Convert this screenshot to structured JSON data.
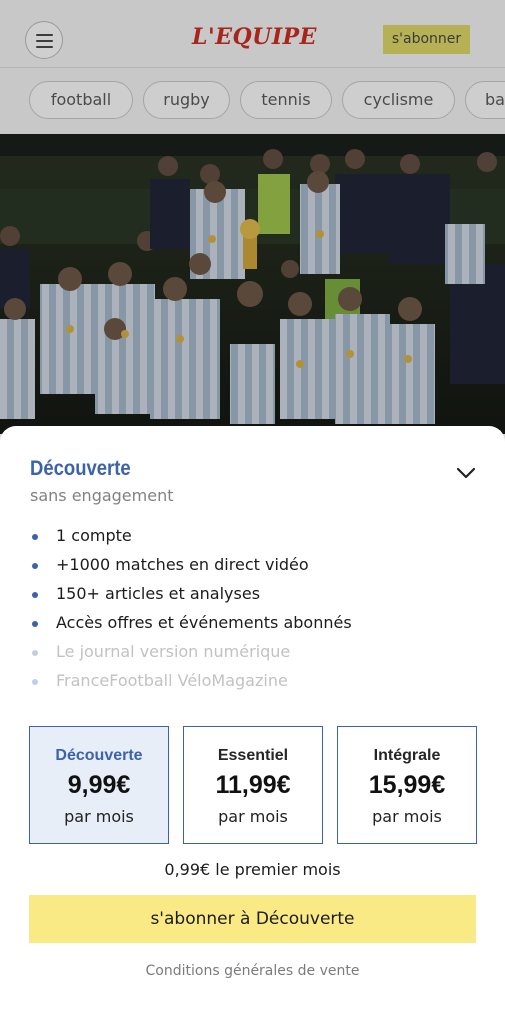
{
  "header": {
    "logo": "L'EQUIPE",
    "subscribe_label": "s'abonner"
  },
  "sports": [
    "football",
    "rugby",
    "tennis",
    "cyclisme",
    "ba"
  ],
  "offer": {
    "title": "Découverte",
    "subtitle": "sans engagement",
    "features": [
      {
        "label": "1 compte",
        "included": true
      },
      {
        "label": "+1000 matches en direct vidéo",
        "included": true
      },
      {
        "label": "150+ articles et analyses",
        "included": true
      },
      {
        "label": "Accès offres et événements abonnés",
        "included": true
      },
      {
        "label": "Le journal version numérique",
        "included": false
      },
      {
        "label": "FranceFootball VéloMagazine",
        "included": false
      }
    ],
    "plans": [
      {
        "name": "Découverte",
        "price": "9,99€",
        "period": "par mois",
        "selected": true
      },
      {
        "name": "Essentiel",
        "price": "11,99€",
        "period": "par mois",
        "selected": false
      },
      {
        "name": "Intégrale",
        "price": "15,99€",
        "period": "par mois",
        "selected": false
      }
    ],
    "promo": "0,99€ le premier mois",
    "cta_label": "s'abonner à Découverte",
    "terms_link": "Conditions générales de vente"
  },
  "colors": {
    "accent_blue": "#3b62ad",
    "cta_yellow": "#f9ea85",
    "logo_red": "#a8251b"
  }
}
